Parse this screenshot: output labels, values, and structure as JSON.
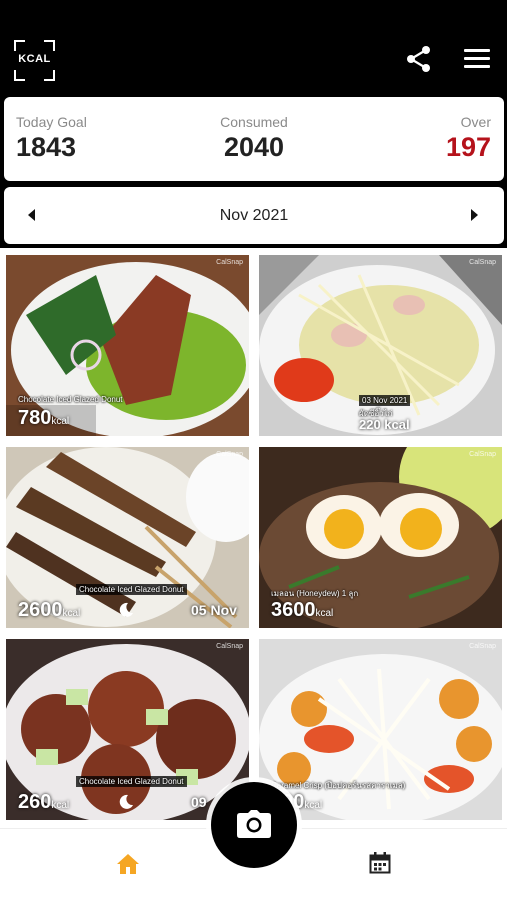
{
  "header": {
    "logo_text": "KCAL",
    "share_icon": "share-icon",
    "menu_icon": "hamburger-menu-icon"
  },
  "summary": {
    "goal_label": "Today Goal",
    "goal_value": "1843",
    "consumed_label": "Consumed",
    "consumed_value": "2040",
    "over_label": "Over",
    "over_value": "197",
    "over_color": "#b5121b"
  },
  "month_nav": {
    "label": "Nov  2021"
  },
  "tiles": [
    {
      "caption": "Chocolate Iced Glazed Donut",
      "kcal": "780",
      "unit": "kcal"
    },
    {
      "caption_date": "03 Nov 2021",
      "caption": "ผัดซีอิ๊วไก่",
      "kcal": "220 kcal"
    },
    {
      "caption": "Chocolate Iced Glazed Donut",
      "kcal": "2600",
      "unit": "kcal",
      "date": "05 Nov"
    },
    {
      "caption": "เมลอน (Honeydew) 1 ลูก",
      "kcal": "3600",
      "unit": "kcal"
    },
    {
      "caption": "Chocolate Iced Glazed Donut",
      "kcal": "260",
      "unit": "kcal",
      "date": "09"
    },
    {
      "caption": "Caramel Crisp (ป๊อปคอร์นรสคาราเมล)",
      "kcal": "100",
      "unit": "kcal"
    }
  ],
  "watermark": "CalSnap",
  "colors": {
    "accent": "#f5a623",
    "over": "#b5121b"
  }
}
